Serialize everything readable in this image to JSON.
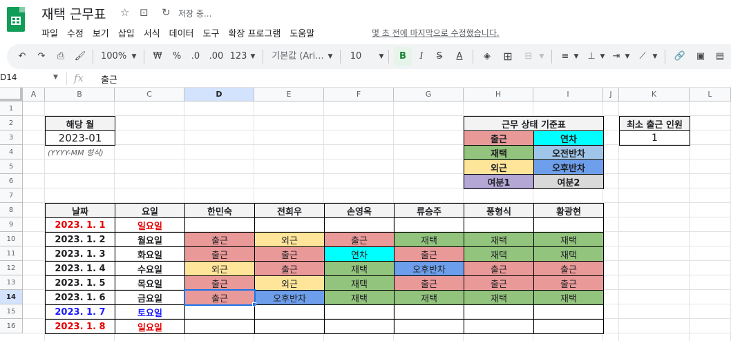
{
  "app": {
    "title": "재택 근무표",
    "save_status": "저장 중...",
    "last_edit": "몇 초 전에 마지막으로 수정했습니다.",
    "menu": [
      "파일",
      "수정",
      "보기",
      "삽입",
      "서식",
      "데이터",
      "도구",
      "확장 프로그램",
      "도움말"
    ]
  },
  "toolbar": {
    "zoom": "100%",
    "currency": "₩",
    "percent": "%",
    "dec_less": ".0",
    "dec_more": ".00",
    "num_format": "123",
    "font": "기본값 (Ari...",
    "font_size": "10",
    "bold": "B",
    "italic": "I",
    "strike": "S",
    "text_color": "A"
  },
  "formula_bar": {
    "name_box": "D14",
    "fx": "fx",
    "value": "출근"
  },
  "columns": [
    "A",
    "B",
    "C",
    "D",
    "E",
    "F",
    "G",
    "H",
    "I",
    "J",
    "K",
    "L"
  ],
  "rows": [
    "1",
    "2",
    "3",
    "4",
    "5",
    "6",
    "7",
    "8",
    "9",
    "10",
    "11",
    "12",
    "13",
    "14",
    "15",
    "16"
  ],
  "month_box": {
    "label": "해당 월",
    "value": "2023-01",
    "hint": "(YYYY-MM 형식)"
  },
  "legend": {
    "title": "근무 상태 기준표",
    "items": [
      "출근",
      "연차",
      "재택",
      "오전반차",
      "외근",
      "오후반차",
      "여분1",
      "여분2"
    ]
  },
  "min_staff": {
    "label": "최소 출근 인원",
    "value": "1"
  },
  "schedule": {
    "headers": [
      "날짜",
      "요일",
      "한민숙",
      "전희우",
      "손영옥",
      "류승주",
      "풍형식",
      "황광현"
    ],
    "rows": [
      {
        "date": "2023. 1. 1",
        "day": "일요일",
        "cells": [
          "",
          "",
          "",
          "",
          "",
          ""
        ]
      },
      {
        "date": "2023. 1. 2",
        "day": "월요일",
        "cells": [
          "출근",
          "외근",
          "출근",
          "재택",
          "재택",
          "재택"
        ]
      },
      {
        "date": "2023. 1. 3",
        "day": "화요일",
        "cells": [
          "출근",
          "출근",
          "연차",
          "출근",
          "재택",
          "재택"
        ]
      },
      {
        "date": "2023. 1. 4",
        "day": "수요일",
        "cells": [
          "외근",
          "출근",
          "재택",
          "오후반차",
          "출근",
          "출근"
        ]
      },
      {
        "date": "2023. 1. 5",
        "day": "목요일",
        "cells": [
          "출근",
          "외근",
          "재택",
          "출근",
          "출근",
          "출근"
        ]
      },
      {
        "date": "2023. 1. 6",
        "day": "금요일",
        "cells": [
          "출근",
          "오후반차",
          "재택",
          "재택",
          "재택",
          "재택"
        ]
      },
      {
        "date": "2023. 1. 7",
        "day": "토요일",
        "cells": [
          "",
          "",
          "",
          "",
          "",
          ""
        ]
      },
      {
        "date": "2023. 1. 8",
        "day": "일요일",
        "cells": [
          "",
          "",
          "",
          "",
          "",
          ""
        ]
      }
    ]
  },
  "colors": {
    "출근": "#ea9999",
    "연차": "#00ffff",
    "재택": "#93c47d",
    "오전반차": "#9fc5e8",
    "외근": "#ffe599",
    "오후반차": "#6d9eeb",
    "여분1": "#b4a7d6",
    "여분2": "#d9d9d9",
    "sunday": "#e60000",
    "saturday": "#1a1aff",
    "selection": "#1a73e8"
  }
}
